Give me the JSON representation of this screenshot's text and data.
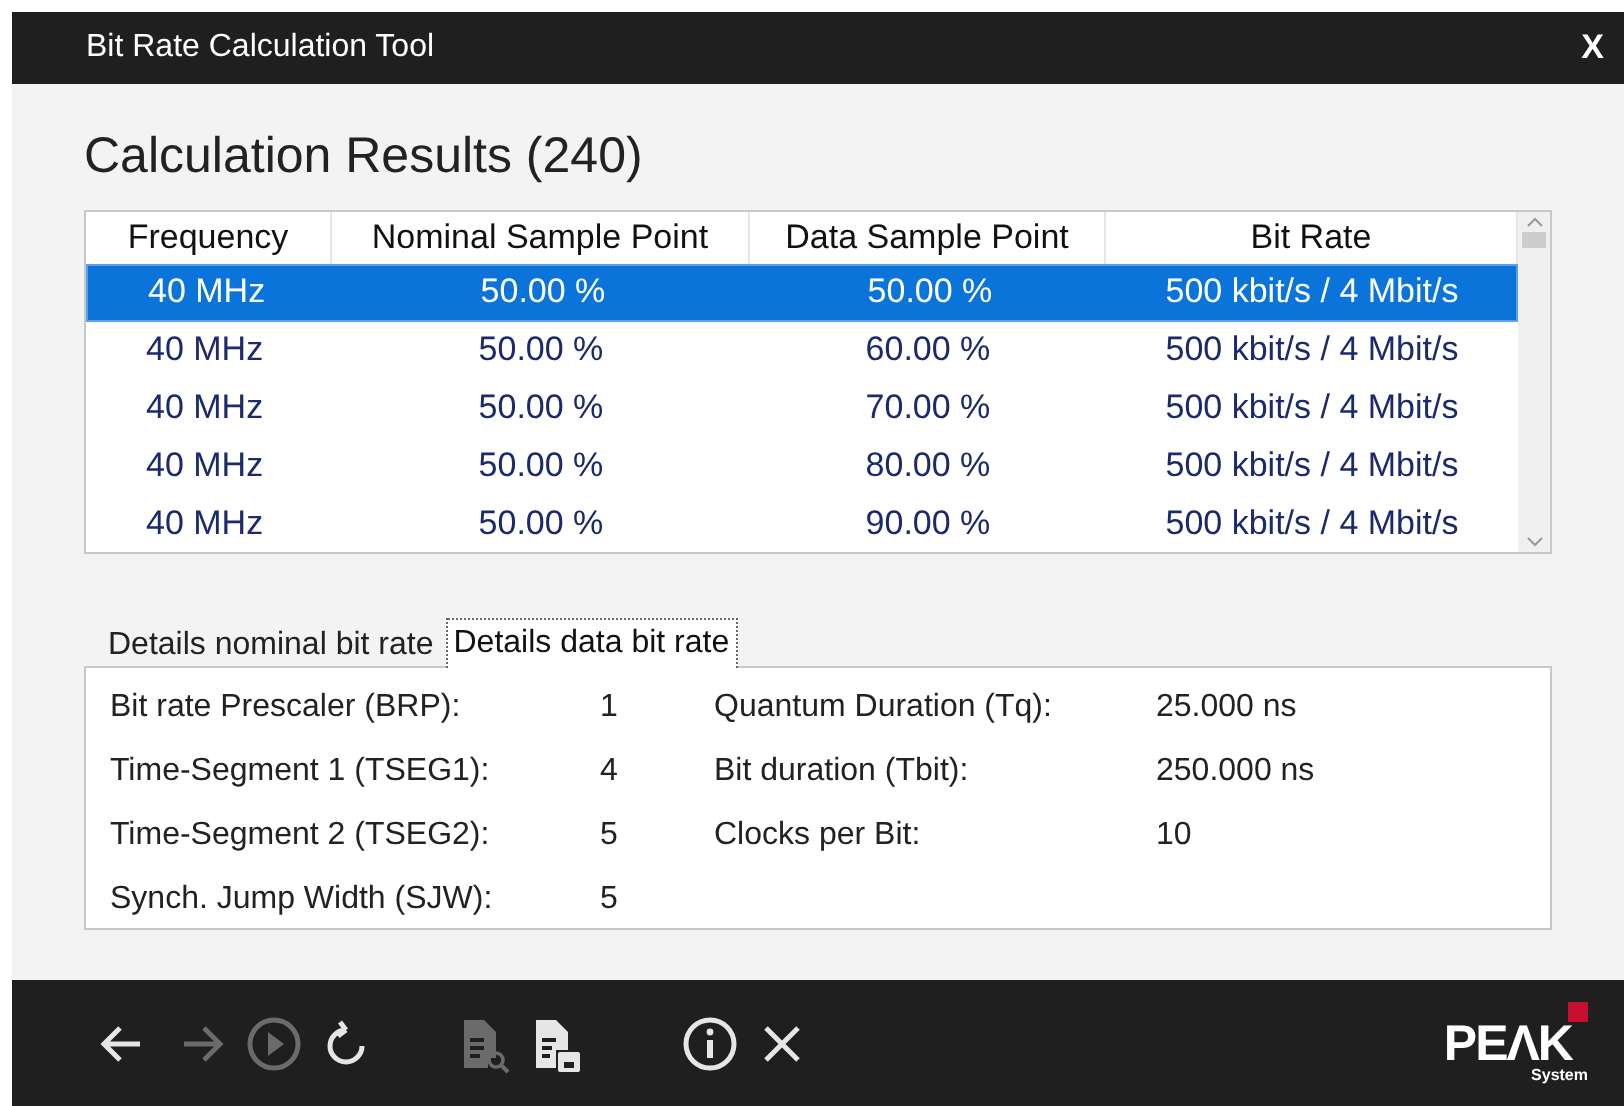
{
  "window": {
    "title": "Bit Rate Calculation Tool",
    "close_label": "X"
  },
  "heading": "Calculation Results (240)",
  "table": {
    "columns": [
      "Frequency",
      "Nominal Sample Point",
      "Data Sample Point",
      "Bit Rate"
    ],
    "rows": [
      {
        "cells": [
          "40 MHz",
          "50.00 %",
          "50.00 %",
          "500 kbit/s / 4 Mbit/s"
        ],
        "selected": true
      },
      {
        "cells": [
          "40 MHz",
          "50.00 %",
          "60.00 %",
          "500 kbit/s / 4 Mbit/s"
        ],
        "selected": false
      },
      {
        "cells": [
          "40 MHz",
          "50.00 %",
          "70.00 %",
          "500 kbit/s / 4 Mbit/s"
        ],
        "selected": false
      },
      {
        "cells": [
          "40 MHz",
          "50.00 %",
          "80.00 %",
          "500 kbit/s / 4 Mbit/s"
        ],
        "selected": false
      },
      {
        "cells": [
          "40 MHz",
          "50.00 %",
          "90.00 %",
          "500 kbit/s / 4 Mbit/s"
        ],
        "selected": false
      }
    ]
  },
  "tabs": [
    {
      "label": "Details nominal bit rate",
      "selected": false
    },
    {
      "label": "Details data bit rate",
      "selected": true
    }
  ],
  "details": [
    {
      "label": "Bit rate Prescaler (BRP):",
      "value": "1",
      "label_2": "Quantum Duration (Tq):",
      "value_2": "25.000 ns"
    },
    {
      "label": "Time-Segment 1 (TSEG1):",
      "value": "4",
      "label_2": "Bit duration (Tbit):",
      "value_2": "250.000 ns"
    },
    {
      "label": "Time-Segment 2 (TSEG2):",
      "value": "5",
      "label_2": "Clocks per Bit:",
      "value_2": "10"
    },
    {
      "label": "Synch. Jump Width (SJW):",
      "value": "5"
    }
  ],
  "toolbar": [
    {
      "kind": "back",
      "disabled": false
    },
    {
      "kind": "forward",
      "disabled": true
    },
    {
      "kind": "play",
      "disabled": true
    },
    {
      "kind": "refresh",
      "disabled": false
    },
    {
      "kind": "report-view",
      "disabled": true
    },
    {
      "kind": "report-save",
      "disabled": false
    },
    {
      "kind": "info",
      "disabled": false
    },
    {
      "kind": "close",
      "disabled": false
    }
  ],
  "logo": {
    "name": "PEΛK",
    "tagline": "System"
  }
}
